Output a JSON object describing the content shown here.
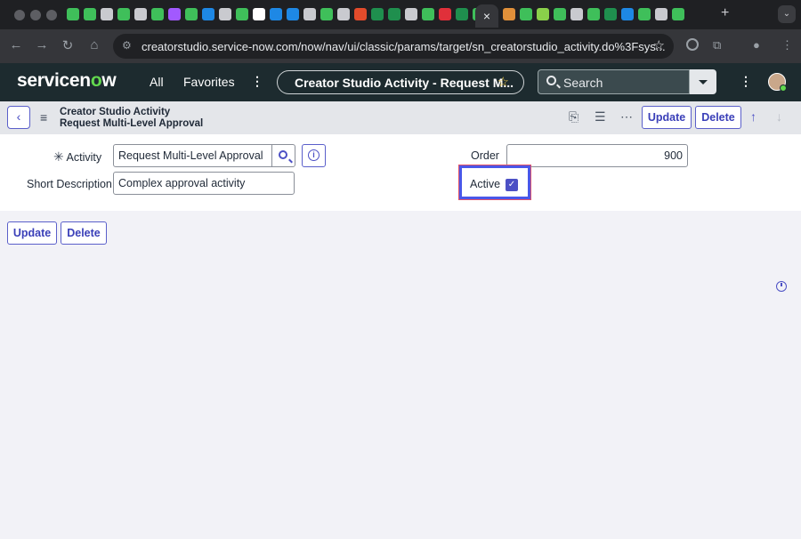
{
  "browser": {
    "active_tab_close": "×",
    "new_tab": "+",
    "url": "creatorstudio.service-now.com/now/nav/ui/classic/params/target/sn_creatorstudio_activity.do%3Fsys...",
    "tab_icon_colors": [
      "#3fbf5a",
      "#3fbf5a",
      "#c9cacf",
      "#3fbf5a",
      "#c9cacf",
      "#3fbf5a",
      "#a259ff",
      "#3fbf5a",
      "#1e88e5",
      "#c9cacf",
      "#3fbf5a",
      "#ffffff",
      "#1e88e5",
      "#1e88e5",
      "#c9cacf",
      "#3fbf5a",
      "#c9cacf",
      "#e34b2b",
      "#1f8f4e",
      "#1f8f4e",
      "#c9cacf",
      "#3fbf5a",
      "#e0303a",
      "#1f8f4e",
      "#3fbf5a",
      "#e0903a",
      "#3fbf5a",
      "#8ad04a",
      "#3fbf5a",
      "#c9cacf",
      "#3fbf5a",
      "#1f8f4e",
      "#1e88e5",
      "#3fbf5a",
      "#c9cacf",
      "#3fbf5a"
    ]
  },
  "header": {
    "logo_prefix": "servicen",
    "logo_o": "o",
    "logo_suffix": "w",
    "nav_all": "All",
    "nav_favorites": "Favorites",
    "context_pill": "Creator Studio Activity - Request M...",
    "search_placeholder": "Search"
  },
  "form_header": {
    "title_line1": "Creator Studio Activity",
    "title_line2": "Request Multi-Level Approval",
    "update_label": "Update",
    "delete_label": "Delete"
  },
  "form": {
    "activity_label": "Activity",
    "activity_value": "Request Multi-Level Approval",
    "short_description_label": "Short Description",
    "short_description_value": "Complex approval activity",
    "order_label": "Order",
    "order_value": "900",
    "active_label": "Active",
    "active_checked": true
  },
  "footer_buttons": {
    "update_label": "Update",
    "delete_label": "Delete"
  },
  "colors": {
    "accent": "#4c50c5",
    "header_bg": "#1d2b2f",
    "logo_green": "#62d84e",
    "highlight_border": "#4a57e8"
  }
}
